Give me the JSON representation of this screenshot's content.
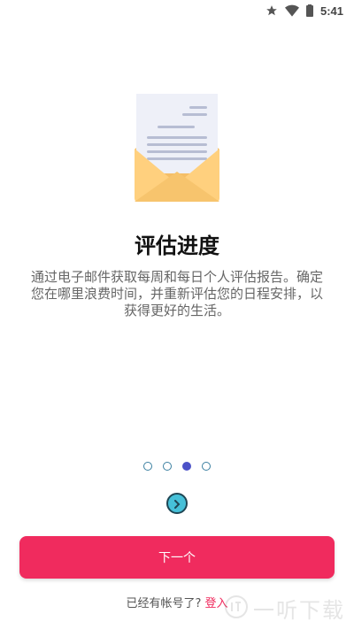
{
  "status_bar": {
    "time": "5:41",
    "icons": [
      "star-icon",
      "wifi-icon",
      "battery-icon"
    ]
  },
  "onboarding": {
    "title": "评估进度",
    "description": "通过电子邮件获取每周和每日个人评估报告。确定您在哪里浪费时间，并重新评估您的日程安排，以获得更好的生活。",
    "page_indicator": {
      "total": 4,
      "active_index": 2
    }
  },
  "actions": {
    "next_label": "下一个",
    "have_account_text": "已经有帐号了?",
    "login_label": "登入"
  },
  "watermark": {
    "text": "一听下载"
  },
  "colors": {
    "accent": "#f02b5e",
    "indicator_active": "#4c52c8",
    "arrow_bg": "#46c0d8"
  }
}
